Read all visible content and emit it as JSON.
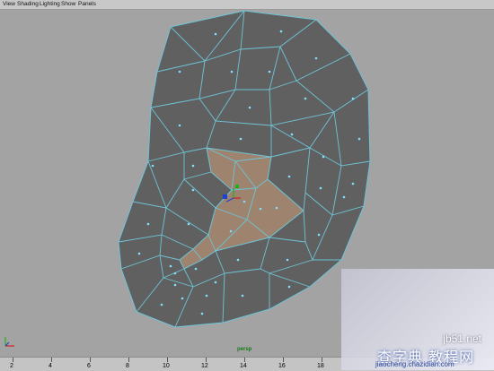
{
  "menu": {
    "items": [
      "View",
      "Shading",
      "Lighting",
      "Show",
      "Panels"
    ]
  },
  "viewport": {
    "camera": "persp",
    "colors": {
      "background": "#a3a3a3",
      "face": "#606060",
      "selected_face": "#a98a72",
      "edge": "#6ec4d6",
      "face_dot": "#7fe0ff"
    }
  },
  "manipulator": {
    "axes": [
      "x",
      "y",
      "z"
    ],
    "colors": {
      "x": "#d02020",
      "y": "#20b020",
      "z": "#2040d0"
    }
  },
  "timeline": {
    "ticks": [
      "2",
      "4",
      "6",
      "8",
      "10",
      "12",
      "14",
      "16",
      "18"
    ]
  },
  "watermark": {
    "site": "jb51.net",
    "cn_text": "查字典 教程网",
    "url": "jiaocheng.chazidian.com"
  }
}
